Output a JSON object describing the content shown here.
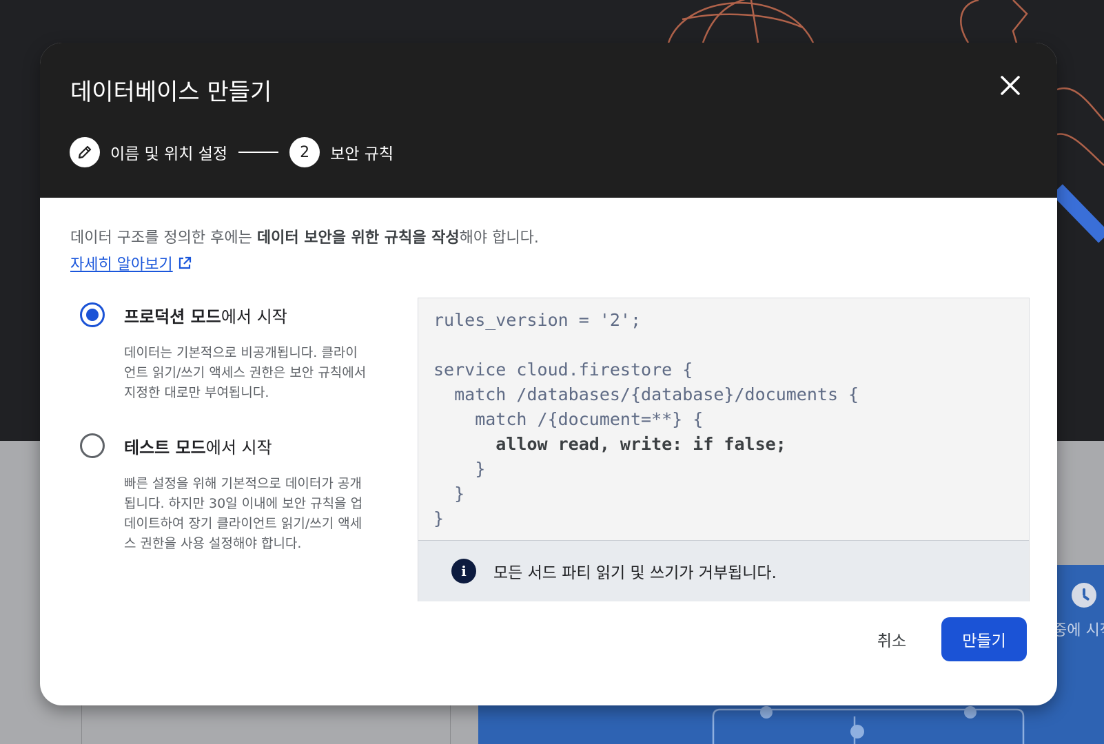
{
  "background": {
    "side_text": "중에 시작"
  },
  "dialog": {
    "title": "데이터베이스 만들기",
    "close_icon": "close-icon",
    "steps": [
      {
        "label": "이름 및 위치 설정",
        "icon": "pencil-icon",
        "state": "completed"
      },
      {
        "number": "2",
        "label": "보안 규칙",
        "state": "current"
      }
    ],
    "description": {
      "before": "데이터 구조를 정의한 후에는 ",
      "bold": "데이터 보안을 위한 규칙을 작성",
      "after": "해야 합니다."
    },
    "learn_more": {
      "label": "자세히 알아보기",
      "icon": "external-link-icon"
    },
    "options": [
      {
        "title_bold": "프로덕션 모드",
        "title_rest": "에서 시작",
        "selected": true,
        "description": "데이터는 기본적으로 비공개됩니다. 클라이언트 읽기/쓰기 액세스 권한은 보안 규칙에서 지정한 대로만 부여됩니다."
      },
      {
        "title_bold": "테스트 모드",
        "title_rest": "에서 시작",
        "selected": false,
        "description": "빠른 설정을 위해 기본적으로 데이터가 공개됩니다. 하지만 30일 이내에 보안 규칙을 업데이트하여 장기 클라이언트 읽기/쓰기 액세스 권한을 사용 설정해야 합니다."
      }
    ],
    "code": {
      "lines": [
        "rules_version = '2';",
        "",
        "service cloud.firestore {",
        "  match /databases/{database}/documents {",
        "    match /{document=**} {",
        "      allow read, write: if false;",
        "    }",
        "  }",
        "}"
      ],
      "bold_line_index": 5
    },
    "info": {
      "icon": "info-icon",
      "text": "모든 서드 파티 읽기 및 쓰기가 거부됩니다."
    },
    "buttons": {
      "cancel": "취소",
      "create": "만들기"
    }
  },
  "colors": {
    "primary": "#1b53d6",
    "header": "#1f1f1f",
    "link": "#1a56db"
  }
}
